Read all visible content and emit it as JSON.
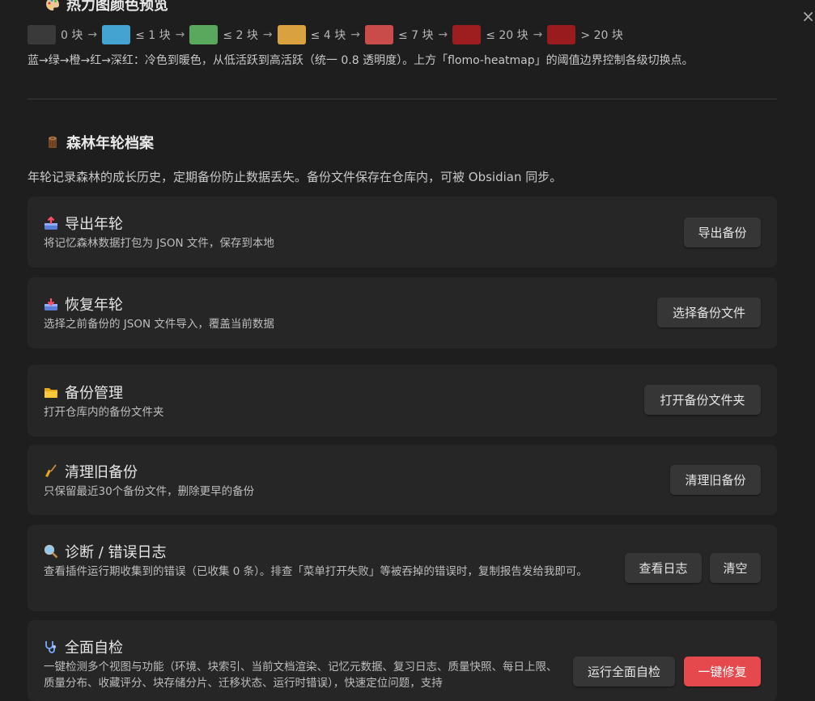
{
  "heatmap_preview": {
    "title": "热力图颜色预览",
    "levels": [
      {
        "color": "#3a3a3a",
        "label": "0 块"
      },
      {
        "color": "#45a3d1",
        "label": "≤ 1 块"
      },
      {
        "color": "#5aa85d",
        "label": "≤ 2 块"
      },
      {
        "color": "#d9a23e",
        "label": "≤ 4 块"
      },
      {
        "color": "#c94c4a",
        "label": "≤ 7 块"
      },
      {
        "color": "#9e1d1f",
        "label": "≤ 20 块"
      },
      {
        "color": "#9a1b1d",
        "label": "> 20 块"
      }
    ],
    "arrow": "→",
    "note": "蓝→绿→橙→红→深红：冷色到暖色，从低活跃到高活跃（统一 0.8 透明度）。上方「flomo-heatmap」的阈值边界控制各级切换点。"
  },
  "archive": {
    "title": "森林年轮档案",
    "desc": "年轮记录森林的成长历史，定期备份防止数据丢失。备份文件保存在仓库内，可被 Obsidian 同步。"
  },
  "cards": {
    "export": {
      "title": "导出年轮",
      "desc": "将记忆森林数据打包为 JSON 文件，保存到本地",
      "button": "导出备份"
    },
    "restore": {
      "title": "恢复年轮",
      "desc": "选择之前备份的 JSON 文件导入，覆盖当前数据",
      "button": "选择备份文件"
    },
    "manage": {
      "title": "备份管理",
      "desc": "打开仓库内的备份文件夹",
      "button": "打开备份文件夹"
    },
    "cleanup": {
      "title": "清理旧备份",
      "desc": "只保留最近30个备份文件，删除更早的备份",
      "button": "清理旧备份"
    },
    "diagnostics": {
      "title": "诊断 / 错误日志",
      "desc": "查看插件运行期收集到的错误（已收集 0 条）。排查「菜单打开失败」等被吞掉的错误时，复制报告发给我即可。",
      "button_view": "查看日志",
      "button_clear": "清空"
    },
    "selfcheck": {
      "title": "全面自检",
      "desc": "一键检测多个视图与功能（环境、块索引、当前文档渲染、记忆元数据、复习日志、质量快照、每日上限、质量分布、收藏评分、块存储分片、迁移状态、运行时错误），快速定位问题，支持",
      "button_run": "运行全面自检",
      "button_fix": "一键修复"
    }
  }
}
